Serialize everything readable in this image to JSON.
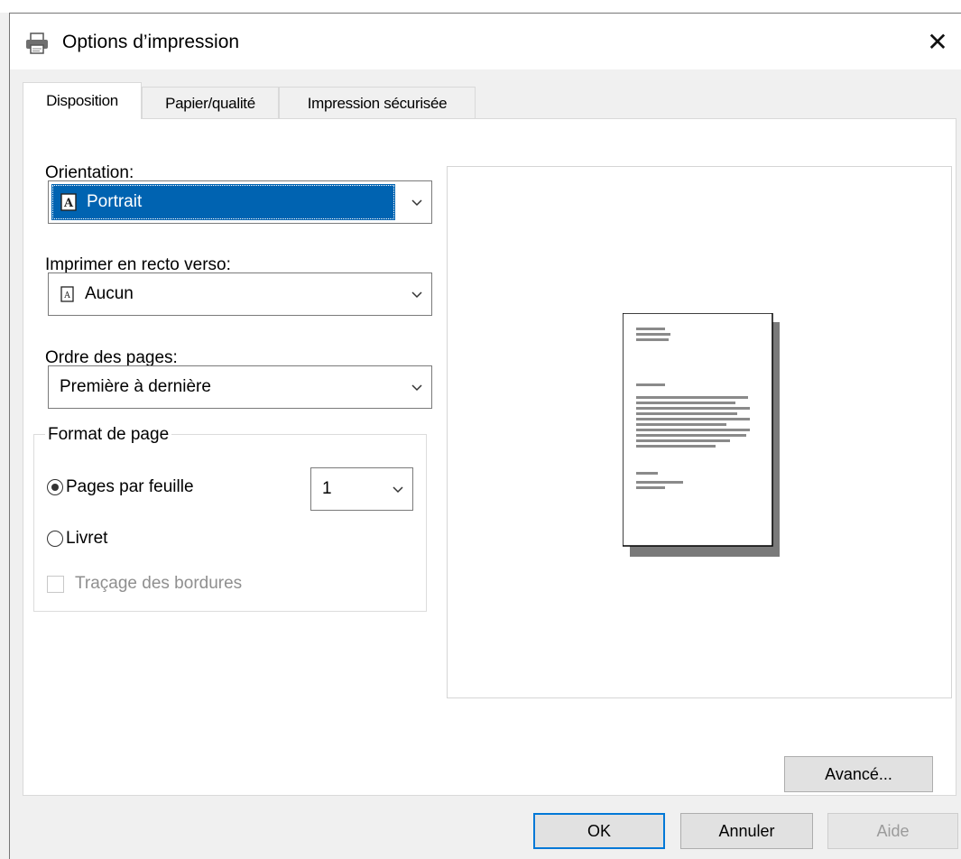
{
  "window": {
    "title": "Options d’impression",
    "close_glyph": "✕"
  },
  "tabs": [
    {
      "label": "Disposition",
      "active": true
    },
    {
      "label": "Papier/qualité",
      "active": false
    },
    {
      "label": "Impression sécurisée",
      "active": false
    }
  ],
  "orientation": {
    "label": "Orientation:",
    "value": "Portrait"
  },
  "duplex": {
    "label": "Imprimer en recto verso:",
    "value": "Aucun"
  },
  "page_order": {
    "label": "Ordre des pages:",
    "value": "Première à dernière"
  },
  "page_format": {
    "title": "Format de page",
    "pages_per_sheet_label": "Pages par feuille",
    "pages_per_sheet_value": "1",
    "pages_per_sheet_selected": true,
    "booklet_label": "Livret",
    "booklet_selected": false,
    "border_label": "Traçage des bordures",
    "border_checked": false,
    "border_enabled": false
  },
  "buttons": {
    "advanced": "Avancé...",
    "ok": "OK",
    "cancel": "Annuler",
    "help": "Aide"
  },
  "colors": {
    "accent": "#0078d7",
    "selection": "#0063b1"
  }
}
